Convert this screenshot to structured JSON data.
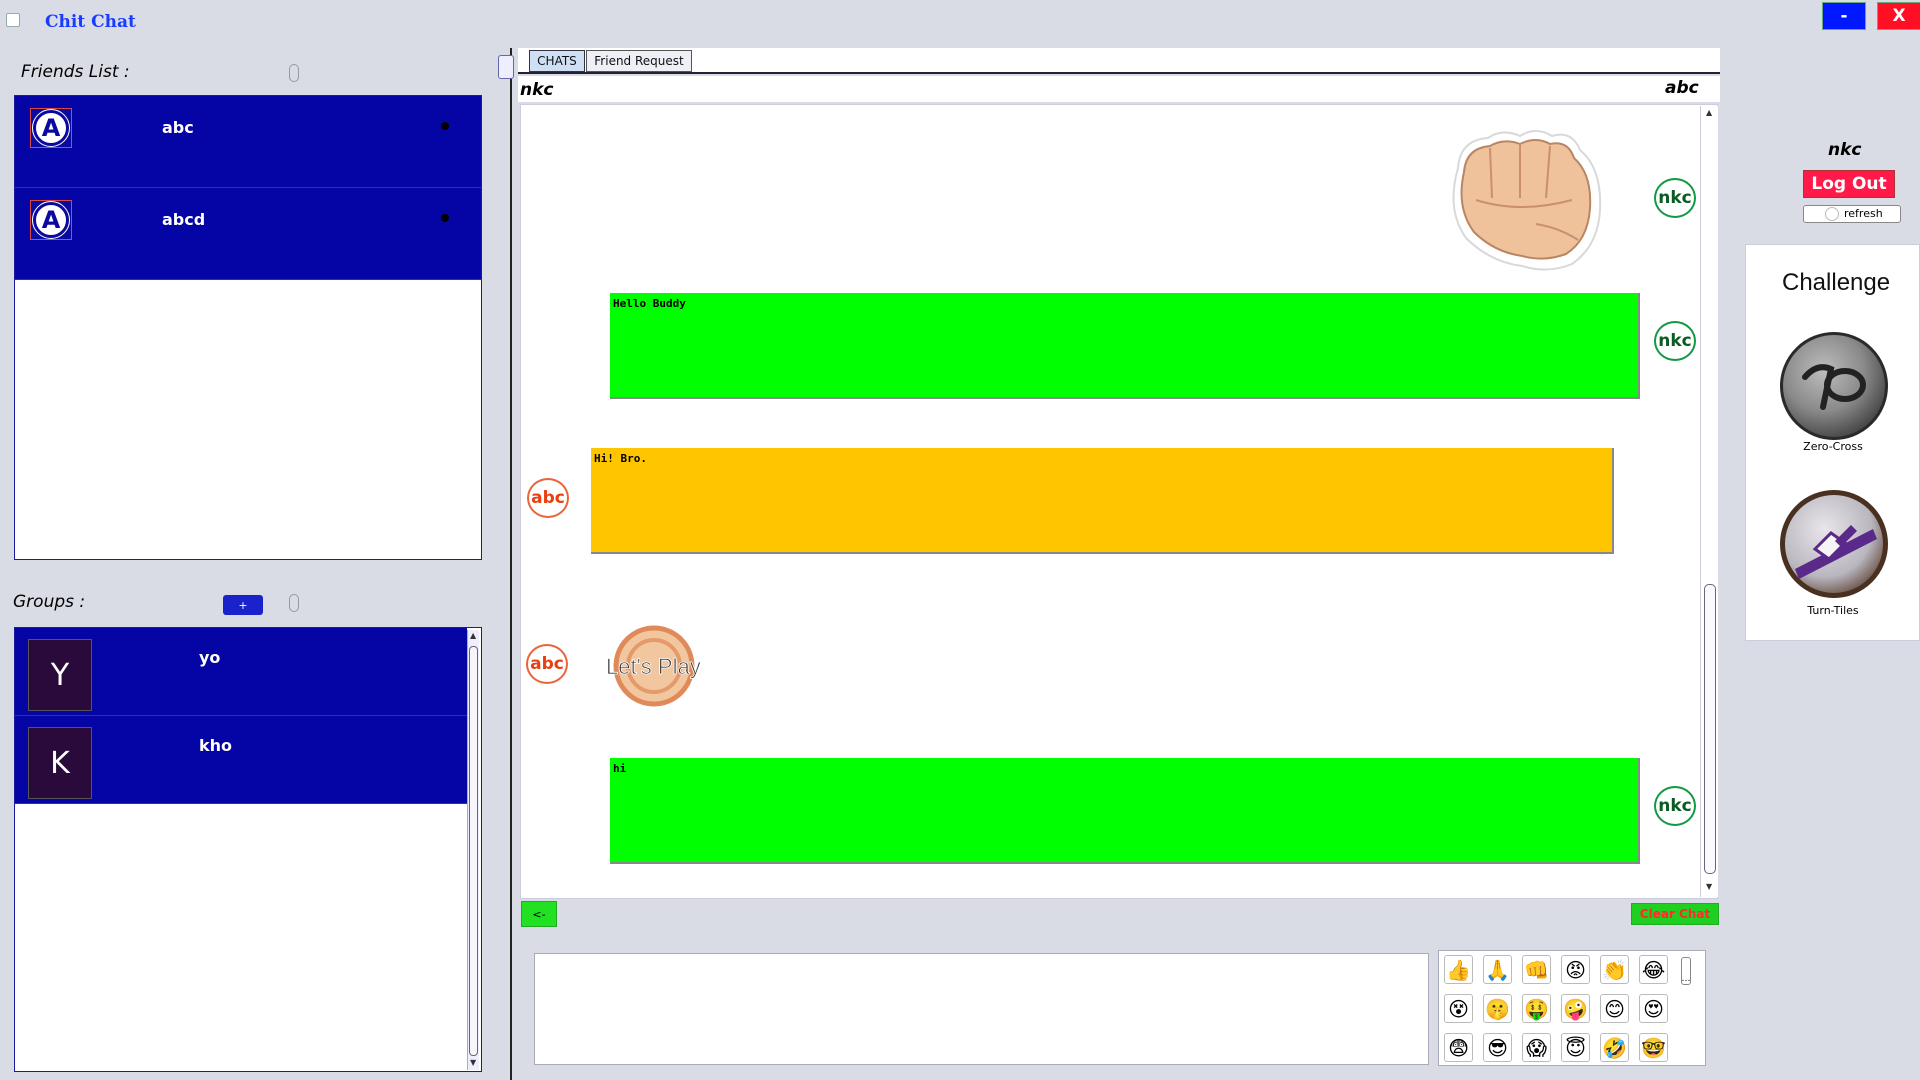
{
  "app": {
    "title": "Chit Chat"
  },
  "window": {
    "minimize_label": "-",
    "close_label": "X"
  },
  "friends": {
    "label": "Friends List :",
    "items": [
      {
        "initial": "A",
        "name": "abc"
      },
      {
        "initial": "A",
        "name": "abcd"
      }
    ]
  },
  "groups": {
    "label": "Groups :",
    "add_label": "+",
    "items": [
      {
        "initial": "Y",
        "name": "yo"
      },
      {
        "initial": "K",
        "name": "kho"
      }
    ]
  },
  "tabs": {
    "chats": "CHATS",
    "friend_request": "Friend Request"
  },
  "chat": {
    "me": "nkc",
    "partner": "abc",
    "messages": [
      {
        "sender": "nkc",
        "type": "sticker",
        "sticker": "fist-bump-sticker"
      },
      {
        "sender": "nkc",
        "type": "text",
        "text": "Hello Buddy"
      },
      {
        "sender": "abc",
        "type": "text",
        "text": "Hi! Bro."
      },
      {
        "sender": "abc",
        "type": "sticker",
        "sticker": "lets-play-sticker",
        "sticker_text": "Let's Play"
      },
      {
        "sender": "nkc",
        "type": "text",
        "text": "hi"
      }
    ],
    "back_label": "<-",
    "clear_label": "Clear Chat"
  },
  "emojis": [
    "👍",
    "🙏",
    "👊",
    "😡",
    "👏",
    "😂",
    "😵",
    "🤫",
    "🤑",
    "🤪",
    "😊",
    "😍",
    "😨",
    "😎",
    "😱",
    "😇",
    "🤣",
    "🤓"
  ],
  "user_panel": {
    "username": "nkc",
    "logout_label": "Log Out",
    "refresh_label": "refresh"
  },
  "challenge": {
    "title": "Challenge",
    "games": [
      {
        "name": "Zero-Cross"
      },
      {
        "name": "Turn-Tiles"
      }
    ]
  },
  "colors": {
    "friend_row": "#0505a5",
    "message_mine": "#00ff00",
    "message_theirs": "#ffc600",
    "logout": "#ff1a4a"
  }
}
